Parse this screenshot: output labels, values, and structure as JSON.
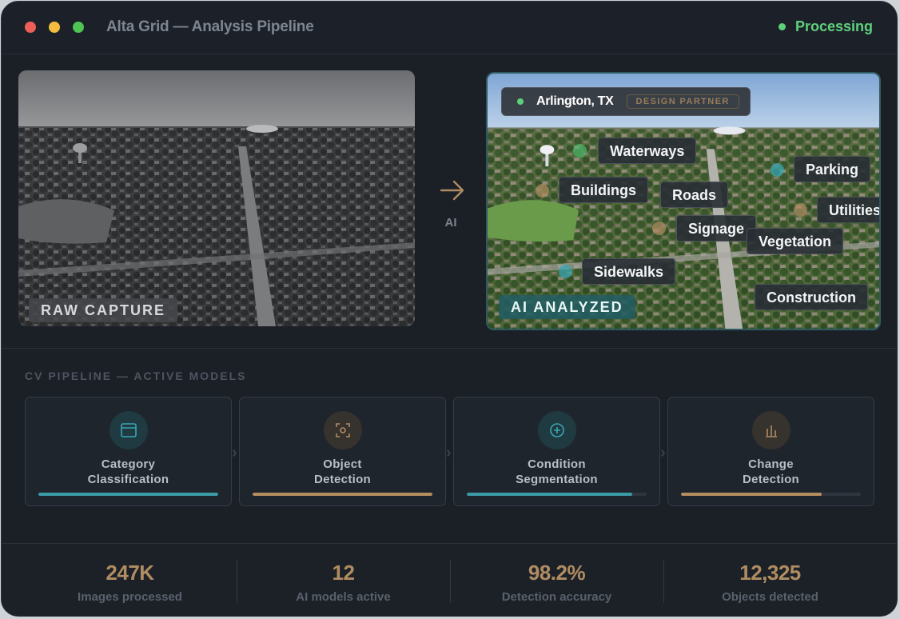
{
  "window": {
    "title": "Alta Grid — Analysis Pipeline",
    "status": "Processing",
    "status_color": "#5fd07c"
  },
  "comparison": {
    "raw_label": "RAW CAPTURE",
    "arrow_label": "AI",
    "analyzed_label": "AI ANALYZED",
    "location": "Arlington, TX",
    "partner_tag": "DESIGN PARTNER"
  },
  "detections": [
    {
      "label": "Waterways",
      "marker_color": "#4fb86a"
    },
    {
      "label": "Buildings",
      "marker_color": "#b08c62"
    },
    {
      "label": "Roads"
    },
    {
      "label": "Parking",
      "marker_color": "#3aa5b0"
    },
    {
      "label": "Utilities",
      "marker_color": "#b08c62"
    },
    {
      "label": "Signage",
      "marker_color": "#b08c62"
    },
    {
      "label": "Vegetation"
    },
    {
      "label": "Sidewalks",
      "marker_color": "#3aa5b0"
    },
    {
      "label": "Construction"
    }
  ],
  "pipeline": {
    "title": "CV PIPELINE — ACTIVE MODELS",
    "models": [
      {
        "name_line1": "Category",
        "name_line2": "Classification",
        "icon": "layout-icon",
        "progress": 1.0,
        "color": "#3a9aa6"
      },
      {
        "name_line1": "Object",
        "name_line2": "Detection",
        "icon": "focus-target-icon",
        "progress": 1.0,
        "color": "#b58d5e"
      },
      {
        "name_line1": "Condition",
        "name_line2": "Segmentation",
        "icon": "plus-circle-icon",
        "progress": 0.92,
        "color": "#3a9aa6"
      },
      {
        "name_line1": "Change",
        "name_line2": "Detection",
        "icon": "bar-chart-icon",
        "progress": 0.78,
        "color": "#b58d5e"
      }
    ]
  },
  "stats": [
    {
      "value": "247K",
      "label": "Images processed"
    },
    {
      "value": "12",
      "label": "AI models active"
    },
    {
      "value": "98.2%",
      "label": "Detection accuracy"
    },
    {
      "value": "12,325",
      "label": "Objects detected"
    }
  ]
}
